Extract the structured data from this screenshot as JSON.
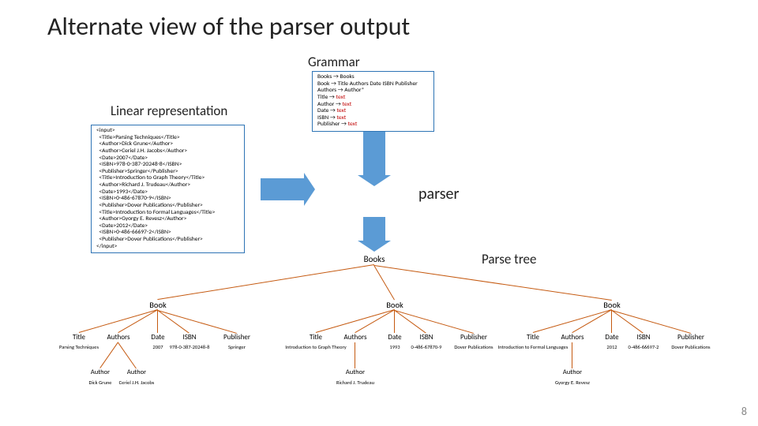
{
  "title": "Alternate view of the parser output",
  "labels": {
    "grammar": "Grammar",
    "linear": "Linear representation",
    "parser": "parser",
    "parsetree": "Parse tree"
  },
  "grammar_rules": [
    "Books → Books",
    "Book → Title Authors Date ISBN Publisher",
    "Authors → Author*",
    "Title → text",
    "Author → text",
    "Date → text",
    "ISBN → text",
    "Publisher → text"
  ],
  "input_lines": [
    "<input>",
    "  <Title>Parsing Techniques</Title>",
    "  <Author>Dick Grune</Author>",
    "  <Author>Ceriel J.H. Jacobs</Author>",
    "  <Date>2007</Date>",
    "  <ISBN>978-0-387-20248-8</ISBN>",
    "  <Publisher>Springer</Publisher>",
    "  <Title>Introduction to Graph Theory</Title>",
    "  <Author>Richard J. Trudeau</Author>",
    "  <Date>1993</Date>",
    "  <ISBN>0-486-67870-9</ISBN>",
    "  <Publisher>Dover Publications</Publisher>",
    "  <Title>Introduction to Formal Languages</Title>",
    "  <Author>Gyorgy E. Revesz</Author>",
    "  <Date>2012</Date>",
    "  <ISBN>0-486-66697-2</ISBN>",
    "  <Publisher>Dover Publications</Publisher>",
    "</input>"
  ],
  "tree": {
    "root": "Books",
    "books": [
      {
        "label": "Book",
        "title": "Parsing Techniques",
        "authors": [
          "Dick Grune",
          "Ceriel J.H. Jacobs"
        ],
        "date": "2007",
        "isbn": "978-0-387-20248-8",
        "publisher": "Springer"
      },
      {
        "label": "Book",
        "title": "Introduction to Graph Theory",
        "authors": [
          "Richard J. Trudeau"
        ],
        "date": "1993",
        "isbn": "0-486-67870-9",
        "publisher": "Dover Publications"
      },
      {
        "label": "Book",
        "title": "Introduction to Formal Languages",
        "authors": [
          "Gyorgy E. Revesz"
        ],
        "date": "2012",
        "isbn": "0-486-66697-2",
        "publisher": "Dover Publications"
      }
    ],
    "field_labels": {
      "title": "Title",
      "authors": "Authors",
      "author": "Author",
      "date": "Date",
      "isbn": "ISBN",
      "publisher": "Publisher"
    }
  },
  "pagenum": "8"
}
